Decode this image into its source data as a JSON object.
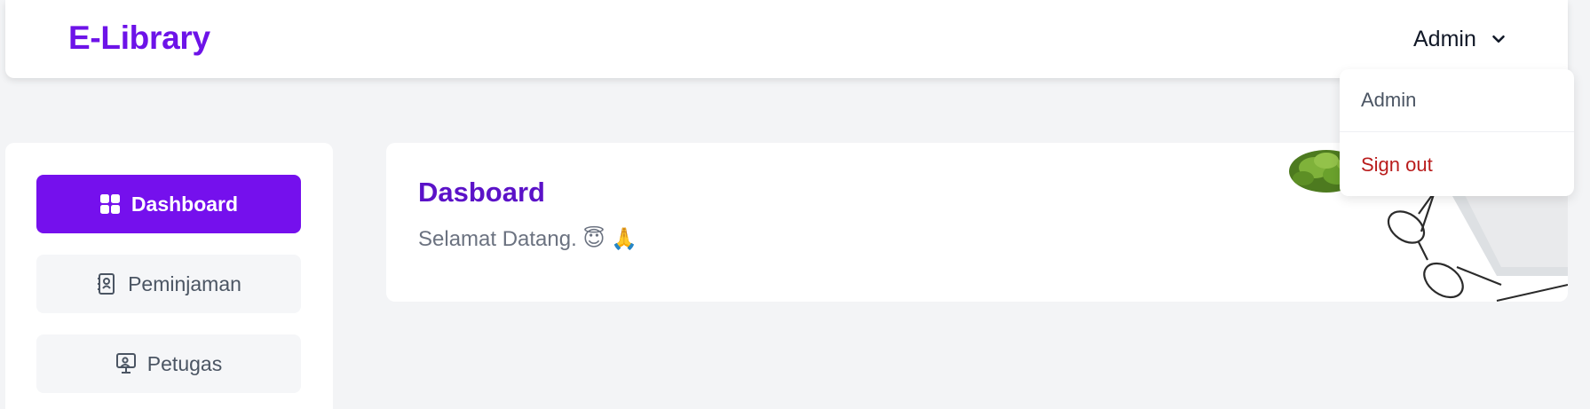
{
  "app": {
    "brand": "E-Library"
  },
  "header": {
    "user_label": "Admin",
    "chevron_icon": "chevron-down-icon"
  },
  "dropdown": {
    "items": [
      {
        "label": "Admin"
      },
      {
        "label": "Sign out"
      }
    ]
  },
  "sidebar": {
    "items": [
      {
        "label": "Dashboard",
        "icon": "dashboard-grid-icon",
        "active": true
      },
      {
        "label": "Peminjaman",
        "icon": "address-book-icon",
        "active": false
      },
      {
        "label": "Petugas",
        "icon": "staff-monitor-icon",
        "active": false
      }
    ]
  },
  "main": {
    "title": "Dasboard",
    "subtitle": "Selamat Datang. 😇 🙏",
    "decor_image": "desk-plant-glasses-illustration"
  },
  "colors": {
    "brand": "#6d13e8",
    "active_nav": "#7510ed",
    "sign_out": "#b91c1c",
    "background": "#f3f4f6"
  }
}
